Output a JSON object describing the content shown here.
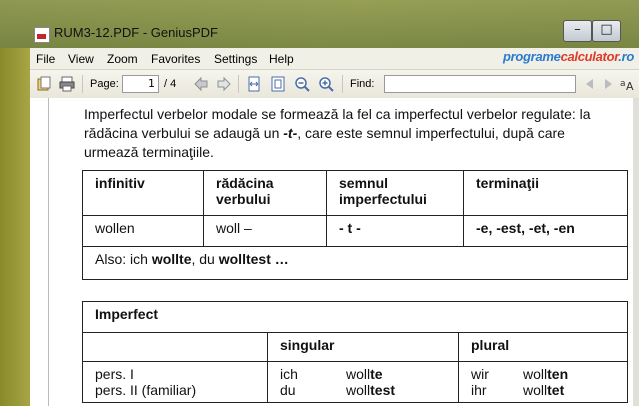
{
  "window": {
    "title": "RUM3-12.PDF - GeniusPDF",
    "minimize": "–",
    "maximize": "□"
  },
  "menu": [
    "File",
    "View",
    "Zoom",
    "Favorites",
    "Settings",
    "Help"
  ],
  "brand": {
    "part1": "programe",
    "part2": "calculator",
    "part3": ".ro"
  },
  "toolbar": {
    "page_label": "Page:",
    "page_value": "1",
    "page_total": "/ 4",
    "find_label": "Find:",
    "find_value": ""
  },
  "document": {
    "intro": [
      "Imperfectul verbelor modale se formează la fel ca imperfectul verbelor regulate: la",
      "rădăcina verbului se adaugă un ",
      "-t-",
      ", care este semnul imperfectului, după care",
      "urmează terminaţiile."
    ],
    "table1": {
      "headers": [
        "infinitiv",
        "rădăcina verbului",
        "semnul imperfectului",
        "terminaţii"
      ],
      "row": [
        "wollen",
        "woll –",
        "- t -",
        "-e, -est, -et, -en"
      ],
      "also": {
        "prefix": "Also:  ich ",
        "w1": "wollte",
        "mid": ", du ",
        "w2": "wolltest",
        "suffix": " …"
      }
    },
    "table2": {
      "title": "Imperfect",
      "col_singular": "singular",
      "col_plural": "plural",
      "rows": [
        {
          "person": "pers. I",
          "s_pron": "ich",
          "s_stem": "woll",
          "s_end": "te",
          "p_pron": "wir",
          "p_stem": "woll",
          "p_end": "ten"
        },
        {
          "person": "pers. II (familiar)",
          "s_pron": "du",
          "s_stem": "woll",
          "s_end": "test",
          "p_pron": "ihr",
          "p_stem": "woll",
          "p_end": "tet"
        }
      ]
    }
  }
}
